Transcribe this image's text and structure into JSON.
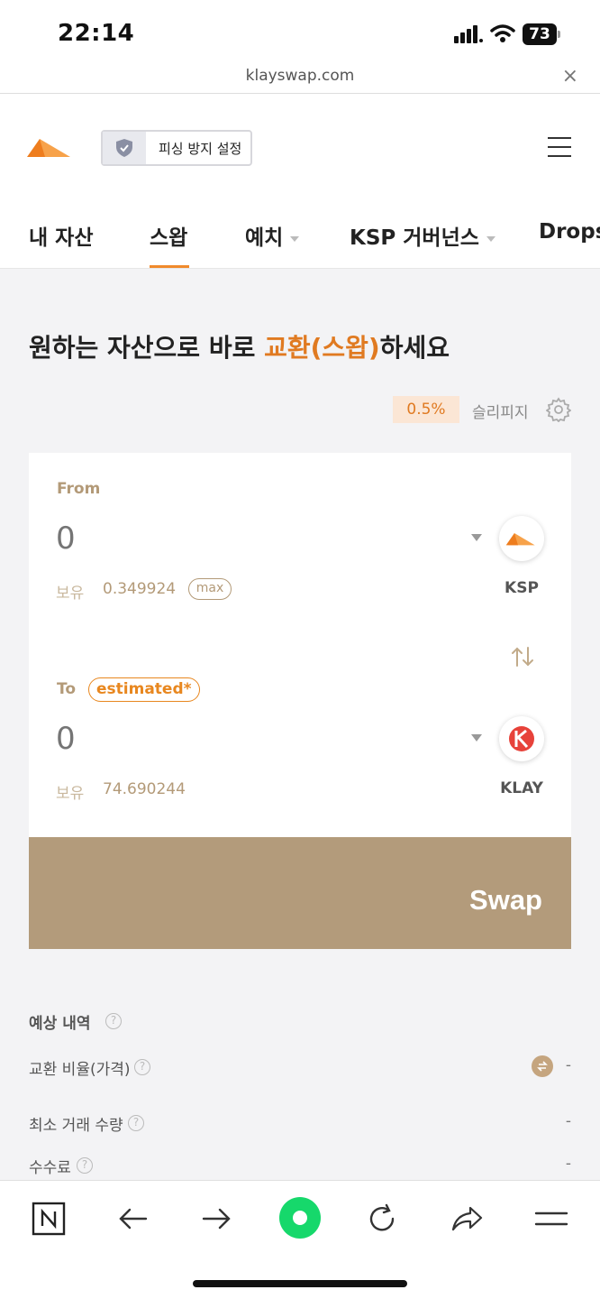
{
  "status_bar": {
    "time": "22:14",
    "battery": "73"
  },
  "browser": {
    "url": "klayswap.com"
  },
  "header": {
    "phishing_button_label": "피싱 방지 설정"
  },
  "nav": {
    "tabs": [
      {
        "label": "내 자산"
      },
      {
        "label": "스왑"
      },
      {
        "label": "예치"
      },
      {
        "label": "KSP 거버넌스"
      },
      {
        "label": "Drops"
      }
    ]
  },
  "headline": {
    "prefix": "원하는 자산으로 바로 ",
    "accent": "교환(스왑)",
    "suffix": "하세요"
  },
  "slippage": {
    "value": "0.5%",
    "label": "슬리피지"
  },
  "swap": {
    "from": {
      "label": "From",
      "placeholder": "0",
      "balance_label": "보유",
      "balance": "0.349924",
      "max_label": "max",
      "token": "KSP"
    },
    "to": {
      "label": "To",
      "estimated_label": "estimated*",
      "placeholder": "0",
      "balance_label": "보유",
      "balance": "74.690244",
      "token": "KLAY"
    },
    "button_label": "Swap"
  },
  "details": {
    "title": "예상 내역",
    "rows": [
      {
        "label": "교환 비율(가격)",
        "value": "-"
      },
      {
        "label": "최소 거래 수량",
        "value": "-"
      },
      {
        "label": "수수료",
        "value": "-"
      }
    ]
  },
  "colors": {
    "accent": "#e07a21",
    "swap_button": "#b39b7b",
    "tan_text": "#b39a78"
  }
}
